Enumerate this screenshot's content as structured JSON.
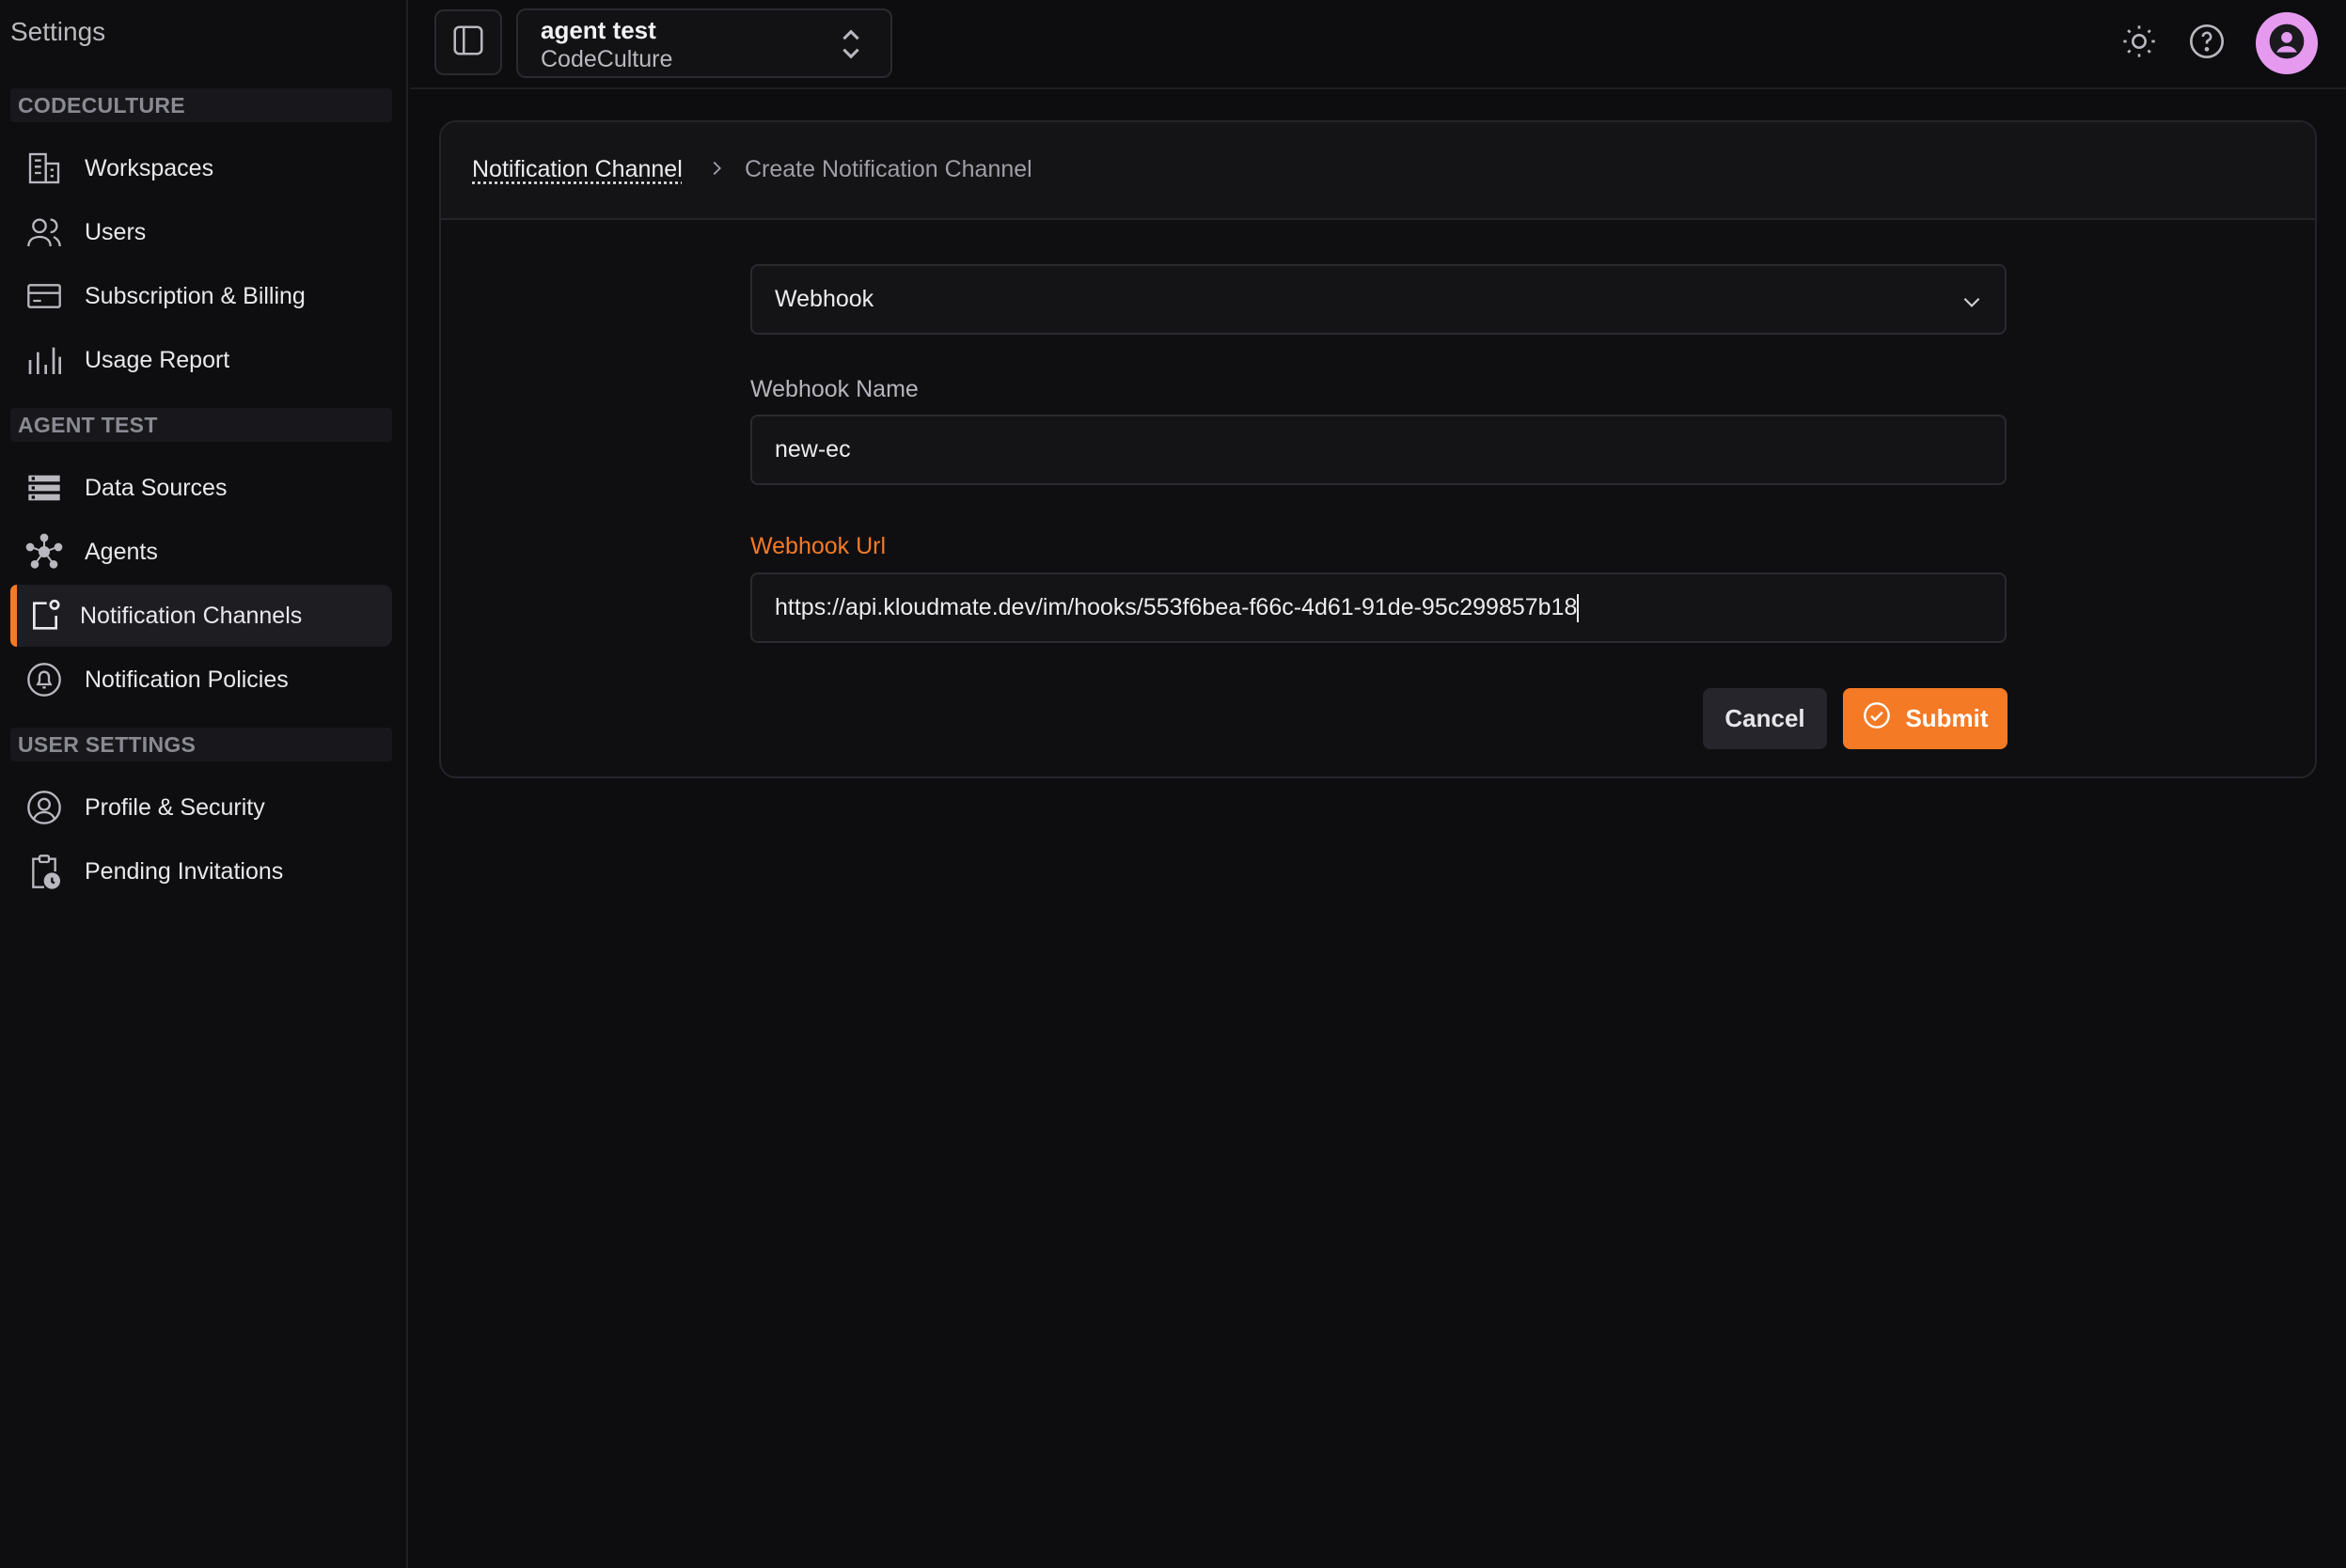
{
  "sidebar": {
    "title": "Settings",
    "sections": [
      {
        "header": "CODECULTURE"
      },
      {
        "header": "AGENT TEST"
      },
      {
        "header": "USER SETTINGS"
      }
    ],
    "items": [
      {
        "label": "Workspaces",
        "icon": "building-icon"
      },
      {
        "label": "Users",
        "icon": "users-icon"
      },
      {
        "label": "Subscription & Billing",
        "icon": "credit-card-icon"
      },
      {
        "label": "Usage Report",
        "icon": "bar-chart-icon"
      },
      {
        "label": "Data Sources",
        "icon": "database-icon"
      },
      {
        "label": "Agents",
        "icon": "agents-network-icon"
      },
      {
        "label": "Notification Channels",
        "icon": "notification-channel-icon",
        "active": true
      },
      {
        "label": "Notification Policies",
        "icon": "bell-circle-icon"
      },
      {
        "label": "Profile & Security",
        "icon": "user-circle-icon"
      },
      {
        "label": "Pending Invitations",
        "icon": "clipboard-clock-icon"
      }
    ]
  },
  "topbar": {
    "workspace_name": "agent test",
    "organization": "CodeCulture"
  },
  "breadcrumb": {
    "parent": "Notification Channel",
    "current": "Create Notification Channel"
  },
  "form": {
    "channel_type": "Webhook",
    "name_label": "Webhook Name",
    "name_value": "new-ec",
    "url_label": "Webhook Url",
    "url_value": "https://api.kloudmate.dev/im/hooks/553f6bea-f66c-4d61-91de-95c299857b18",
    "cancel_label": "Cancel",
    "submit_label": "Submit"
  },
  "colors": {
    "accent": "#f47a26",
    "avatar": "#e59af0",
    "background": "#0d0d10"
  }
}
